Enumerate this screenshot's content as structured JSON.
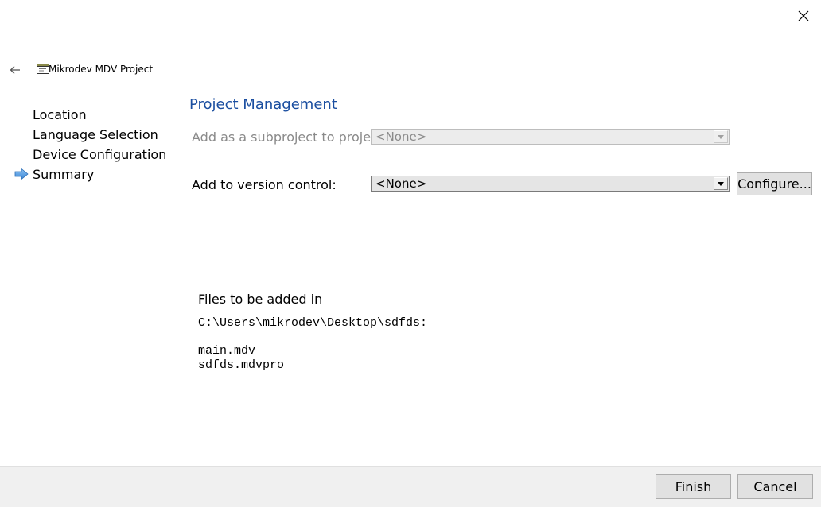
{
  "window": {
    "close_icon": "close-icon"
  },
  "header": {
    "back_icon": "back-arrow-icon",
    "wizard_icon": "project-window-icon",
    "title": "Mikrodev MDV Project"
  },
  "steps": [
    {
      "label": "Location",
      "current": false
    },
    {
      "label": "Language Selection",
      "current": false
    },
    {
      "label": "Device Configuration",
      "current": false
    },
    {
      "label": "Summary",
      "current": true
    }
  ],
  "steps_current_marker_icon": "current-step-arrow-icon",
  "page": {
    "title": "Project Management",
    "title_color": "#1a4ea0",
    "subproject": {
      "label": "Add as a subproject to project:",
      "value": "<None>",
      "enabled": false
    },
    "version_control": {
      "label": "Add to version control:",
      "value": "<None>",
      "enabled": true,
      "configure_label": "Configure..."
    },
    "files": {
      "heading": "Files to be added in",
      "directory": "C:\\Users\\mikrodev\\Desktop\\sdfds:",
      "items": [
        "main.mdv",
        "sdfds.mdvpro"
      ]
    }
  },
  "footer": {
    "finish_label": "Finish",
    "cancel_label": "Cancel"
  }
}
